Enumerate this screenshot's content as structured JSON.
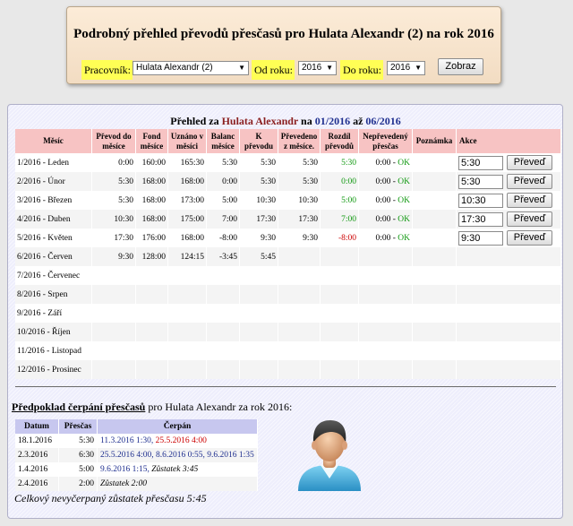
{
  "filter": {
    "title": "Podrobný přehled převodů přesčasů pro Hulata Alexandr (2) na rok 2016",
    "employee_label": "Pracovník:",
    "employee_value": "Hulata Alexandr (2)",
    "from_label": "Od roku:",
    "from_value": "2016",
    "to_label": "Do roku:",
    "to_value": "2016",
    "button_label": "Zobraz"
  },
  "overview": {
    "title_prefix": "Přehled za",
    "title_name": "Hulata Alexandr",
    "title_na": "na",
    "title_from": "01/2016",
    "title_to_word": "až",
    "title_to": "06/2016",
    "headers": [
      "Měsíc",
      "Převod do měsíce",
      "Fond měsíce",
      "Uznáno v měsíci",
      "Balanc měsíce",
      "K převodu",
      "Převedeno z měsíce.",
      "Rozdíl převodů",
      "Nepřevedený přesčas",
      "Poznámka",
      "Akce"
    ],
    "rows": [
      {
        "month": "1/2016 - Leden",
        "prevod": "0:00",
        "fond": "160:00",
        "uznano": "165:30",
        "balanc": "5:30",
        "k_prevodu": "5:30",
        "prevedeno": "5:30",
        "rozdil": "5:30",
        "rozdil_color": "green",
        "neprev_val": "0:00 - ",
        "neprev_ok": "OK",
        "poznamka": "",
        "akce_value": "5:30",
        "akce_button": "Převeď"
      },
      {
        "month": "2/2016 - Únor",
        "prevod": "5:30",
        "fond": "168:00",
        "uznano": "168:00",
        "balanc": "0:00",
        "k_prevodu": "5:30",
        "prevedeno": "5:30",
        "rozdil": "0:00",
        "rozdil_color": "green",
        "neprev_val": "0:00 - ",
        "neprev_ok": "OK",
        "poznamka": "",
        "akce_value": "5:30",
        "akce_button": "Převeď"
      },
      {
        "month": "3/2016 - Březen",
        "prevod": "5:30",
        "fond": "168:00",
        "uznano": "173:00",
        "balanc": "5:00",
        "k_prevodu": "10:30",
        "prevedeno": "10:30",
        "rozdil": "5:00",
        "rozdil_color": "green",
        "neprev_val": "0:00 - ",
        "neprev_ok": "OK",
        "poznamka": "",
        "akce_value": "10:30",
        "akce_button": "Převeď"
      },
      {
        "month": "4/2016 - Duben",
        "prevod": "10:30",
        "fond": "168:00",
        "uznano": "175:00",
        "balanc": "7:00",
        "k_prevodu": "17:30",
        "prevedeno": "17:30",
        "rozdil": "7:00",
        "rozdil_color": "green",
        "neprev_val": "0:00 - ",
        "neprev_ok": "OK",
        "poznamka": "",
        "akce_value": "17:30",
        "akce_button": "Převeď"
      },
      {
        "month": "5/2016 - Květen",
        "prevod": "17:30",
        "fond": "176:00",
        "uznano": "168:00",
        "balanc": "-8:00",
        "k_prevodu": "9:30",
        "prevedeno": "9:30",
        "rozdil": "-8:00",
        "rozdil_color": "red",
        "neprev_val": "0:00 - ",
        "neprev_ok": "OK",
        "poznamka": "",
        "akce_value": "9:30",
        "akce_button": "Převeď"
      },
      {
        "month": "6/2016 - Červen",
        "prevod": "9:30",
        "fond": "128:00",
        "uznano": "124:15",
        "balanc": "-3:45",
        "k_prevodu": "5:45",
        "prevedeno": "",
        "rozdil": "",
        "rozdil_color": "",
        "neprev_val": "",
        "neprev_ok": "",
        "poznamka": "",
        "akce_value": "",
        "akce_button": ""
      },
      {
        "month": "7/2016 - Červenec",
        "prevod": "",
        "fond": "",
        "uznano": "",
        "balanc": "",
        "k_prevodu": "",
        "prevedeno": "",
        "rozdil": "",
        "rozdil_color": "",
        "neprev_val": "",
        "neprev_ok": "",
        "poznamka": "",
        "akce_value": "",
        "akce_button": ""
      },
      {
        "month": "8/2016 - Srpen",
        "prevod": "",
        "fond": "",
        "uznano": "",
        "balanc": "",
        "k_prevodu": "",
        "prevedeno": "",
        "rozdil": "",
        "rozdil_color": "",
        "neprev_val": "",
        "neprev_ok": "",
        "poznamka": "",
        "akce_value": "",
        "akce_button": ""
      },
      {
        "month": "9/2016 - Září",
        "prevod": "",
        "fond": "",
        "uznano": "",
        "balanc": "",
        "k_prevodu": "",
        "prevedeno": "",
        "rozdil": "",
        "rozdil_color": "",
        "neprev_val": "",
        "neprev_ok": "",
        "poznamka": "",
        "akce_value": "",
        "akce_button": ""
      },
      {
        "month": "10/2016 - Říjen",
        "prevod": "",
        "fond": "",
        "uznano": "",
        "balanc": "",
        "k_prevodu": "",
        "prevedeno": "",
        "rozdil": "",
        "rozdil_color": "",
        "neprev_val": "",
        "neprev_ok": "",
        "poznamka": "",
        "akce_value": "",
        "akce_button": ""
      },
      {
        "month": "11/2016 - Listopad",
        "prevod": "",
        "fond": "",
        "uznano": "",
        "balanc": "",
        "k_prevodu": "",
        "prevedeno": "",
        "rozdil": "",
        "rozdil_color": "",
        "neprev_val": "",
        "neprev_ok": "",
        "poznamka": "",
        "akce_value": "",
        "akce_button": ""
      },
      {
        "month": "12/2016 - Prosinec",
        "prevod": "",
        "fond": "",
        "uznano": "",
        "balanc": "",
        "k_prevodu": "",
        "prevedeno": "",
        "rozdil": "",
        "rozdil_color": "",
        "neprev_val": "",
        "neprev_ok": "",
        "poznamka": "",
        "akce_value": "",
        "akce_button": ""
      }
    ]
  },
  "forecast": {
    "title_bold": "Předpoklad čerpání přesčasů",
    "title_rest": " pro Hulata Alexandr za rok 2016:",
    "headers": [
      "Datum",
      "Přesčas",
      "Čerpán"
    ],
    "rows": [
      {
        "datum": "18.1.2016",
        "prescas": "5:30",
        "parts": [
          {
            "t": "11.3.2016 1:30, ",
            "c": "blue"
          },
          {
            "t": "25.5.2016 4:00",
            "c": "red"
          }
        ]
      },
      {
        "datum": "2.3.2016",
        "prescas": "6:30",
        "parts": [
          {
            "t": "25.5.2016 4:00, 8.6.2016 0:55, 9.6.2016 1:35",
            "c": "blue"
          }
        ]
      },
      {
        "datum": "1.4.2016",
        "prescas": "5:00",
        "parts": [
          {
            "t": "9.6.2016 1:15, ",
            "c": "blue"
          },
          {
            "t": "Zůstatek 3:45",
            "c": "italic"
          }
        ]
      },
      {
        "datum": "2.4.2016",
        "prescas": "2:00",
        "parts": [
          {
            "t": "Zůstatek 2:00",
            "c": "italic"
          }
        ]
      }
    ],
    "total": "Celkový nevyčerpaný zůstatek přesčasu 5:45"
  },
  "icons": {
    "avatar": "user-avatar-icon",
    "dropdown": "chevron-down-icon"
  }
}
